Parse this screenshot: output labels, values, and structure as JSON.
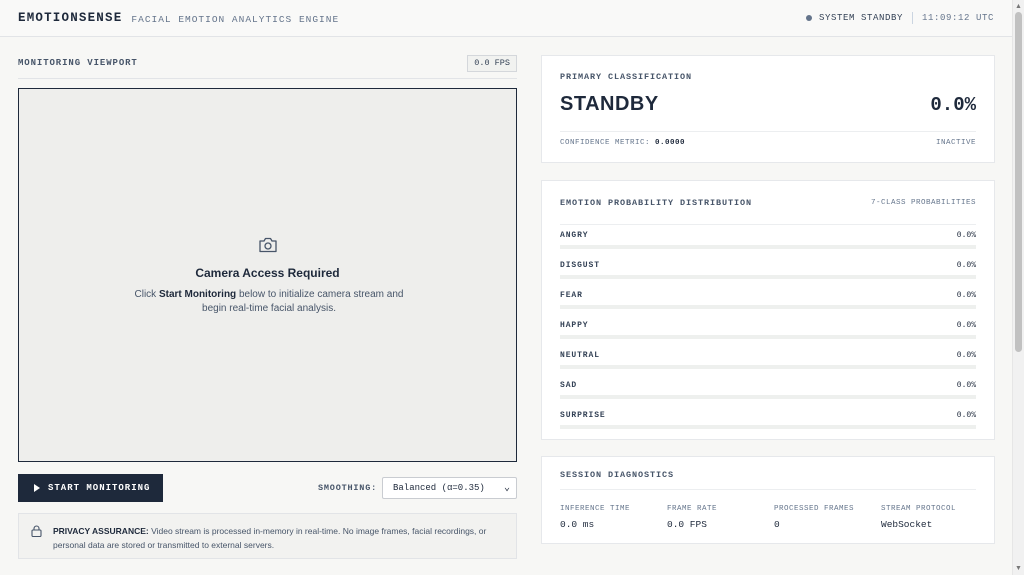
{
  "header": {
    "brand": "EMOTIONSENSE",
    "subtitle": "FACIAL EMOTION ANALYTICS ENGINE",
    "status_label": "SYSTEM STANDBY",
    "time": "11:09:12 UTC"
  },
  "viewport": {
    "title": "MONITORING VIEWPORT",
    "fps": "0.0 FPS",
    "camera_icon": "camera-icon",
    "camera_title": "Camera Access Required",
    "camera_desc_prefix": "Click ",
    "camera_desc_action": "Start Monitoring",
    "camera_desc_suffix": " below to initialize camera stream and begin real-time facial analysis."
  },
  "controls": {
    "start_label": "START MONITORING",
    "smoothing_label": "SMOOTHING:",
    "smoothing_value": "Balanced (α=0.35)"
  },
  "privacy": {
    "lead": "PRIVACY ASSURANCE:",
    "text": " Video stream is processed in-memory in real-time. No image frames, facial recordings, or personal data are stored or transmitted to external servers."
  },
  "primary": {
    "label": "PRIMARY CLASSIFICATION",
    "state": "STANDBY",
    "percent": "0.0%",
    "confidence_label": "CONFIDENCE METRIC:",
    "confidence_value": "0.0000",
    "status": "INACTIVE"
  },
  "distribution": {
    "label": "EMOTION PROBABILITY DISTRIBUTION",
    "sublabel": "7-CLASS PROBABILITIES",
    "emotions": [
      {
        "name": "ANGRY",
        "value": "0.0%",
        "fraction": 0
      },
      {
        "name": "DISGUST",
        "value": "0.0%",
        "fraction": 0
      },
      {
        "name": "FEAR",
        "value": "0.0%",
        "fraction": 0
      },
      {
        "name": "HAPPY",
        "value": "0.0%",
        "fraction": 0
      },
      {
        "name": "NEUTRAL",
        "value": "0.0%",
        "fraction": 0
      },
      {
        "name": "SAD",
        "value": "0.0%",
        "fraction": 0
      },
      {
        "name": "SURPRISE",
        "value": "0.0%",
        "fraction": 0
      }
    ]
  },
  "diagnostics": {
    "label": "SESSION DIAGNOSTICS",
    "metrics": [
      {
        "label": "INFERENCE TIME",
        "value": "0.0 ms"
      },
      {
        "label": "FRAME RATE",
        "value": "0.0 FPS"
      },
      {
        "label": "PROCESSED FRAMES",
        "value": "0"
      },
      {
        "label": "STREAM PROTOCOL",
        "value": "WebSocket"
      }
    ]
  },
  "colors": {
    "accent": "#1e293b",
    "background": "#f7f7f5",
    "status_dot": "#64748b"
  }
}
